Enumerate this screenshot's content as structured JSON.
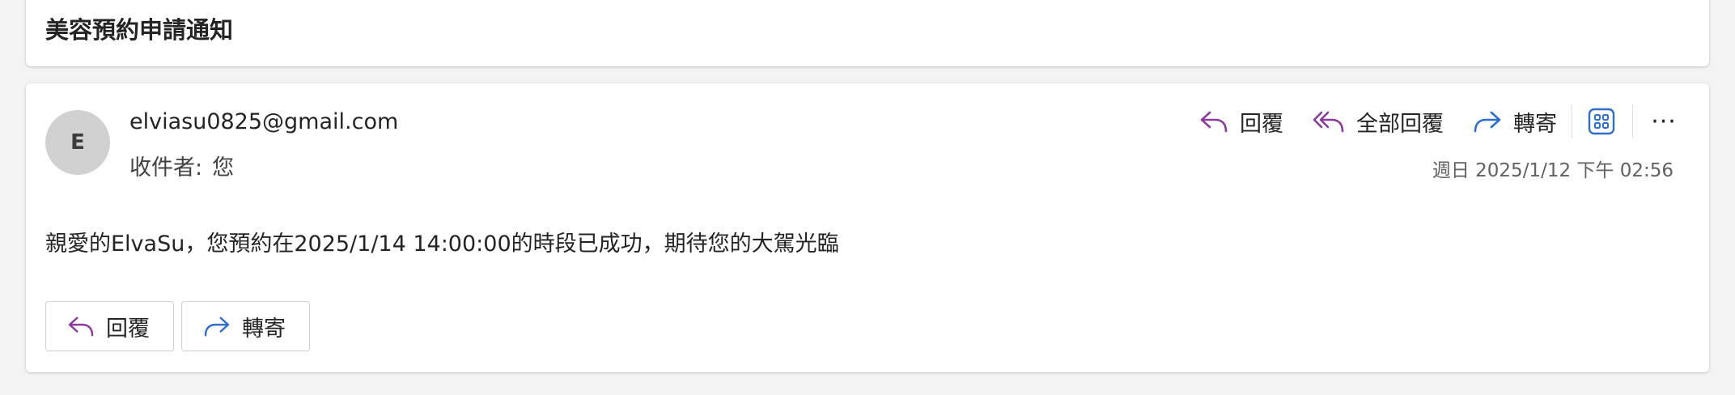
{
  "subject": "美容預約申請通知",
  "message": {
    "avatar_initial": "E",
    "sender": "elviasu0825@gmail.com",
    "to_label": "收件者:",
    "to_value": "您",
    "date": "週日 2025/1/12 下午 02:56",
    "body": "親愛的ElvaSu，您預約在2025/1/14 14:00:00的時段已成功，期待您的大駕光臨"
  },
  "toolbar": {
    "reply": "回覆",
    "reply_all": "全部回覆",
    "forward": "轉寄",
    "apps_icon": "apps-icon",
    "more_icon": "more-icon",
    "more_glyph": "···"
  },
  "footer_buttons": {
    "reply": "回覆",
    "forward": "轉寄"
  },
  "colors": {
    "reply_icon": "#8a3a9b",
    "forward_icon": "#2f6fc9",
    "apps_icon": "#2f6fc9",
    "background": "#f3f3f3"
  }
}
